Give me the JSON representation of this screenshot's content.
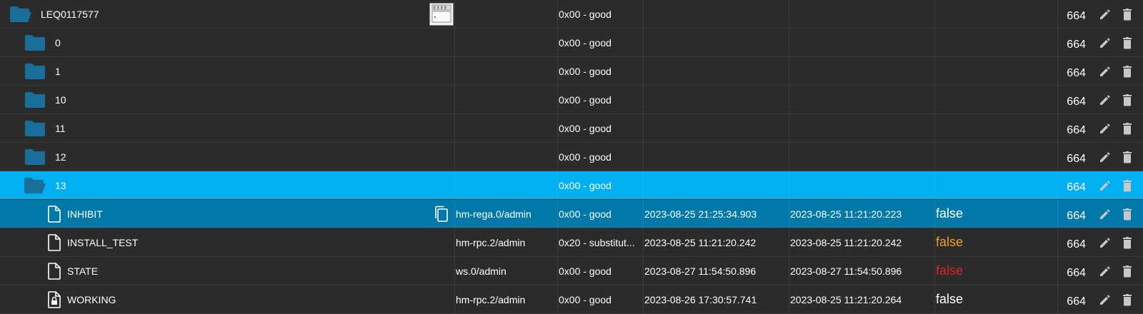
{
  "rows": [
    {
      "name": "LEQ0117577",
      "icon": "folder-open-icon",
      "indent": 0,
      "quality": "0x00 - good",
      "user": "",
      "ts": "",
      "lc": "",
      "value": "",
      "acl": "664",
      "has_device_image": true,
      "state": "normal"
    },
    {
      "name": "0",
      "icon": "folder-icon",
      "indent": 1,
      "quality": "0x00 - good",
      "user": "",
      "ts": "",
      "lc": "",
      "value": "",
      "acl": "664",
      "state": "normal"
    },
    {
      "name": "1",
      "icon": "folder-icon",
      "indent": 1,
      "quality": "0x00 - good",
      "user": "",
      "ts": "",
      "lc": "",
      "value": "",
      "acl": "664",
      "state": "normal"
    },
    {
      "name": "10",
      "icon": "folder-icon",
      "indent": 1,
      "quality": "0x00 - good",
      "user": "",
      "ts": "",
      "lc": "",
      "value": "",
      "acl": "664",
      "state": "normal"
    },
    {
      "name": "11",
      "icon": "folder-icon",
      "indent": 1,
      "quality": "0x00 - good",
      "user": "",
      "ts": "",
      "lc": "",
      "value": "",
      "acl": "664",
      "state": "normal"
    },
    {
      "name": "12",
      "icon": "folder-icon",
      "indent": 1,
      "quality": "0x00 - good",
      "user": "",
      "ts": "",
      "lc": "",
      "value": "",
      "acl": "664",
      "state": "normal"
    },
    {
      "name": "13",
      "icon": "folder-open-icon",
      "indent": 1,
      "quality": "0x00 - good",
      "user": "",
      "ts": "",
      "lc": "",
      "value": "",
      "acl": "664",
      "state": "selected"
    },
    {
      "name": "INHIBIT",
      "icon": "file-icon",
      "indent": 2,
      "quality": "0x00 - good",
      "user": "hm-rega.0/admin",
      "ts": "2023-08-25 21:25:34.903",
      "lc": "2023-08-25 11:21:20.223",
      "value": "false",
      "value_color": "white",
      "acl": "664",
      "state": "active",
      "copy_icon": true
    },
    {
      "name": "INSTALL_TEST",
      "icon": "file-icon",
      "indent": 2,
      "quality": "0x20 - substitut...",
      "user": "hm-rpc.2/admin",
      "ts": "2023-08-25 11:21:20.242",
      "lc": "2023-08-25 11:21:20.242",
      "value": "false",
      "value_color": "orange",
      "acl": "664",
      "state": "normal"
    },
    {
      "name": "STATE",
      "icon": "file-icon",
      "indent": 2,
      "quality": "0x00 - good",
      "user": "ws.0/admin",
      "ts": "2023-08-27 11:54:50.896",
      "lc": "2023-08-27 11:54:50.896",
      "value": "false",
      "value_color": "red",
      "acl": "664",
      "state": "normal"
    },
    {
      "name": "WORKING",
      "icon": "file-lock-icon",
      "indent": 2,
      "quality": "0x00 - good",
      "user": "hm-rpc.2/admin",
      "ts": "2023-08-26 17:30:57.741",
      "lc": "2023-08-25 11:21:20.264",
      "value": "false",
      "value_color": "white",
      "acl": "664",
      "state": "normal"
    }
  ],
  "colors": {
    "folder": "#1a6f9a",
    "selected_bg": "#00b0f0",
    "active_bg": "#0079a8",
    "orange": "#f0a030",
    "red": "#e02424"
  }
}
